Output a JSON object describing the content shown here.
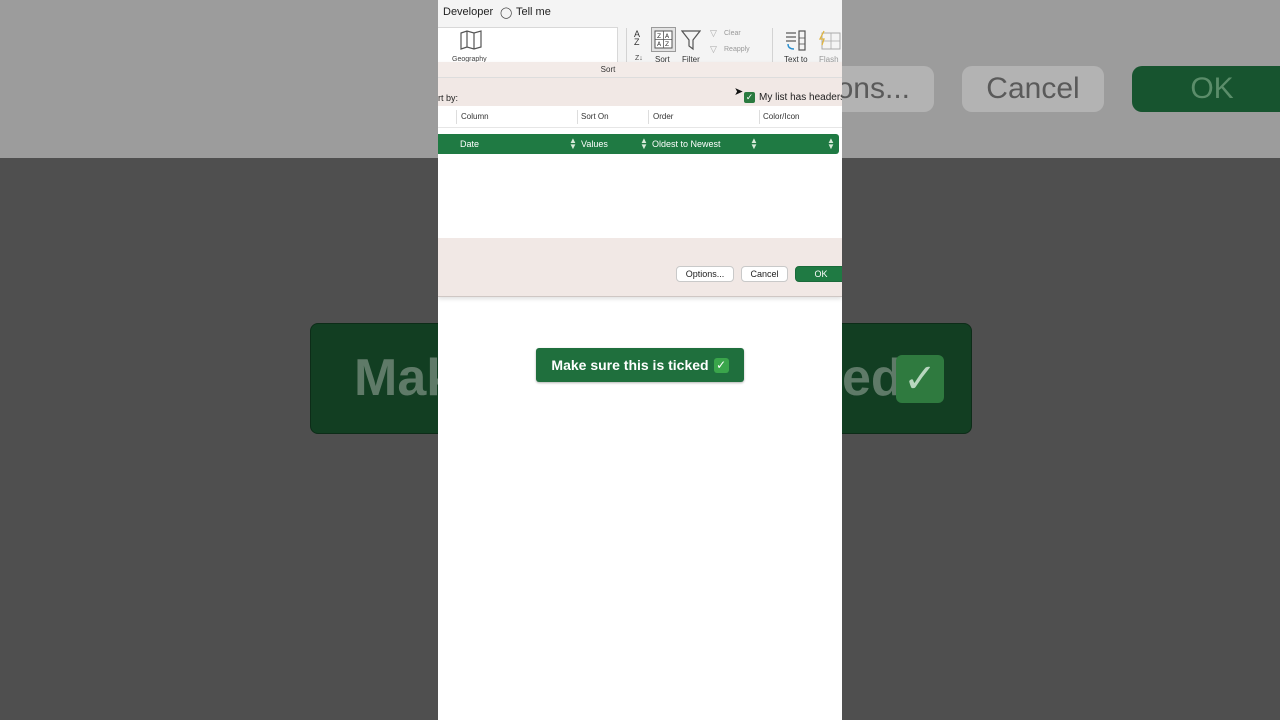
{
  "background": {
    "options_label": "ons...",
    "cancel_label": "Cancel",
    "ok_label": "OK",
    "banner_left": "Mak",
    "banner_right": "ed"
  },
  "ribbon": {
    "tabs": {
      "developer": "Developer",
      "tell_me": "Tell me"
    },
    "geography_label": "Geography",
    "sort_label": "Sort",
    "filter_label": "Filter",
    "clear_label": "Clear",
    "reapply_label": "Reapply",
    "text_to_columns_label": "Text to",
    "flash_fill_label": "Flash",
    "sort_za_label": "Z↓",
    "sort_az_glyph": "A↓Z"
  },
  "dialog": {
    "title": "Sort",
    "sort_by_label": "rt by:",
    "headers_checkbox_label": "My list has headers",
    "headers_checked": true,
    "columns": [
      "Column",
      "Sort On",
      "Order",
      "Color/Icon"
    ],
    "row": {
      "column": "Date",
      "sort_on": "Values",
      "order": "Oldest to Newest",
      "color_icon": ""
    },
    "buttons": {
      "options": "Options...",
      "cancel": "Cancel",
      "ok": "OK"
    }
  },
  "banner": {
    "text": "Make sure this is ticked",
    "check_glyph": "✓"
  },
  "colors": {
    "excel_green": "#1f7a43",
    "banner_green": "#1f6f3d",
    "dialog_bg": "#f1e8e5"
  }
}
